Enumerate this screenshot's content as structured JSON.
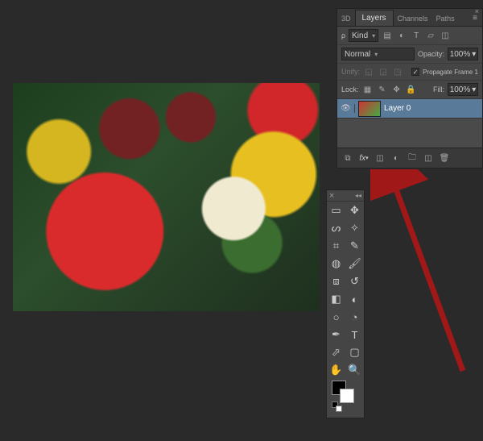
{
  "panel": {
    "tabs": [
      "3D",
      "Layers",
      "Channels",
      "Paths"
    ],
    "activeTab": 1,
    "filterLabel": "Kind",
    "blendMode": "Normal",
    "opacityLabel": "Opacity:",
    "opacityValue": "100%",
    "unifyLabel": "Unify:",
    "propagateLabel": "Propagate Frame 1",
    "lockLabel": "Lock:",
    "fillLabel": "Fill:",
    "fillValue": "100%"
  },
  "layer": {
    "name": "Layer 0"
  },
  "footerIcons": [
    "link",
    "fx",
    "mask",
    "adjust",
    "group",
    "new",
    "trash"
  ],
  "filterIcons": [
    "image",
    "adjust",
    "type",
    "shape",
    "smart"
  ],
  "tools": [
    [
      "rect-marquee",
      "move"
    ],
    [
      "lasso",
      "magic-wand"
    ],
    [
      "crop",
      "eyedropper"
    ],
    [
      "spot-heal",
      "brush"
    ],
    [
      "stamp",
      "history-brush"
    ],
    [
      "eraser",
      "gradient"
    ],
    [
      "blur",
      "dodge"
    ],
    [
      "pen",
      "type"
    ],
    [
      "path-select",
      "rectangle"
    ],
    [
      "hand",
      "zoom"
    ]
  ],
  "toolGlyphs": {
    "rect-marquee": "▭",
    "move": "✥",
    "lasso": "ᔕ",
    "magic-wand": "✧",
    "crop": "⌗",
    "eyedropper": "✎",
    "spot-heal": "◍",
    "brush": "🖌",
    "stamp": "⧈",
    "history-brush": "↺",
    "eraser": "◧",
    "gradient": "◐",
    "blur": "○",
    "dodge": "◔",
    "pen": "✒",
    "type": "T",
    "path-select": "⬀",
    "rectangle": "▢",
    "hand": "✋",
    "zoom": "🔍"
  }
}
